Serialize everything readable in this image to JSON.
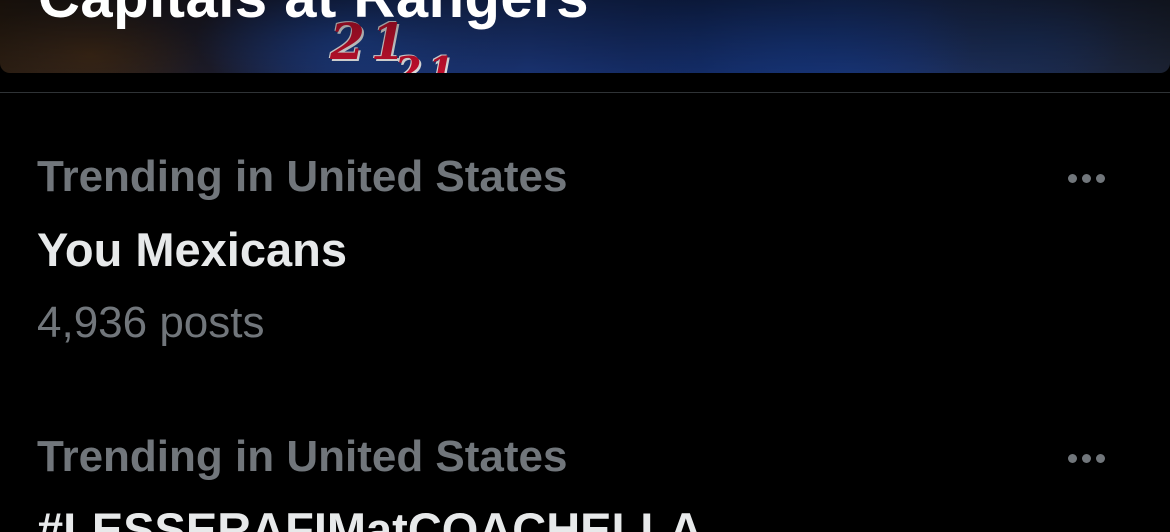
{
  "hero": {
    "headline": "Capitals at Rangers",
    "jersey_number": "21"
  },
  "trends": [
    {
      "context": "Trending in United States",
      "name": "You Mexicans",
      "post_count": "4,936 posts"
    },
    {
      "context": "Trending in United States",
      "name": "#LESSERAFIMatCOACHELLA"
    }
  ],
  "icons": {
    "more": "more-options-icon"
  },
  "colors": {
    "background": "#000000",
    "primary_text": "#e7e9ea",
    "secondary_text": "#71767b",
    "divider": "#2f3336"
  }
}
